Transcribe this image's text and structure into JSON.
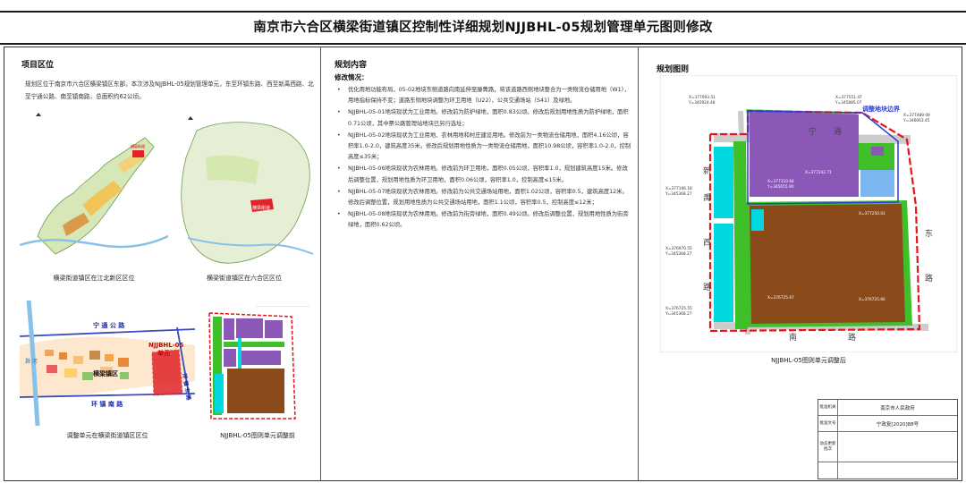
{
  "title": "南京市六合区横梁街道镇区控制性详细规划NJJBHL-05规划管理单元图则修改",
  "left": {
    "heading": "项目区位",
    "intro": "规划区位于南京市六合区横梁镇区东部，本次涉及NJJBHL-05规划管理单元，东至环镇东路、西至新禹西路、北至宁通公路、南至镇南路，总面积约62公顷。",
    "maps": {
      "jiangbei_caption": "横梁街道镇区在江北新区区位",
      "liuhe_caption": "横梁街道镇区在六合区区位",
      "liuhe_label": "横梁街道",
      "jiangbei_label": "横梁街道",
      "town_caption": "调整单元在横梁街道镇区区位",
      "before_caption": "NJJBHL-05图则单元调整前",
      "town_labels": {
        "road_north": "宁 通 公 路",
        "road_south": "环 镇 南 路",
        "road_east": "环 镇 东 路",
        "town": "横梁镇区",
        "unit": "NJJBHL-05",
        "unit2": "单元",
        "river": "滁 河"
      }
    }
  },
  "middle": {
    "heading": "规划内容",
    "subheading": "修改情况：",
    "items": [
      "优化用地功能布局，05-02地块东侧道路向南延伸至滕菁路，将该道路西侧地块整合为一类物流仓储用地（W1），用地指标保持不变；道路东侧地块调整为环卫用地（U22）、公共交通场站（S41）及绿地。",
      "NJJBHL-05-01地块现状为工业用地。修改前为防护绿地，面积0.83公顷。修改后规划用地性质为防护绿地，面积0.71公顷，其中票公路管理站地块已另行选址；",
      "NJJBHL-05-02地块现状为工业用地、农林用地和村庄建设用地。修改前为一类物流仓储用地，面积4.16公顷，容积率1.0-2.0，建筑高度35米。修改后规划用地性质为一类物流仓储用地，面积10.98公顷，容积率1.0-2.0，控制高度≤35米；",
      "NJJBHL-05-06地块现状为农林用地。修改前为环卫用地，面积0.05公顷，容积率1.0，规划建筑高度15米。修改后调整位置，规划用地性质为环卫用地，面积0.06公顷，容积率1.0，控制高度≤15米。",
      "NJJBHL-05-07地块现状为农林用地。修改前为公共交通场站用地，面积1.02公顷，容积率0.5，建筑高度12米。修改后调整位置，规划用地性质为公共交通场站用地，面积1.1公顷，容积率0.5，控制高度≤12米；",
      "NJJBHL-05-08地块现状为农林用地。修改前为街旁绿地，面积0.49公顷。修改后调整位置，规划用地性质为街旁绿地，面积0.62公顷。"
    ]
  },
  "right": {
    "heading": "规划图则",
    "plan_caption": "NJJBHL-05图则单元调整后",
    "boundary_label": "调整地块边界",
    "roads": {
      "north": "宁",
      "north2": "通",
      "road_char_a": "路",
      "west_a": "新",
      "west_b": "禹",
      "west_c": "西",
      "east_a": "东",
      "east_b": "路",
      "south_a": "南",
      "south_b": "路"
    },
    "coords": [
      "X=377093.51",
      "Y=345924.48",
      "X=377551.47",
      "Y=345885.07",
      "X=377489.09",
      "Y=346063.45",
      "X=377196.18",
      "Y=345368.27",
      "X=376970.55",
      "Y=345368.27",
      "X=376725.55",
      "Y=345368.27",
      "X=377242.71",
      "X=377310.64",
      "Y=345655.90",
      "X=377250.01",
      "X=376725.67",
      "X=376725.66"
    ],
    "approval": {
      "rows": [
        {
          "label": "批准机关",
          "value": "南京市人民政府"
        },
        {
          "label": "批准文号",
          "value": "宁政复[2020]88号"
        },
        {
          "label": "动态更新批次",
          "value": ""
        },
        {
          "label": "",
          "value": ""
        }
      ]
    }
  },
  "colors": {
    "logistics": "#8b58b8",
    "industrial": "#8b4a1a",
    "green": "#3fc02a",
    "protect": "#00d8e0",
    "boundary": "#e8121a",
    "adjust": "#2b3fd1"
  }
}
